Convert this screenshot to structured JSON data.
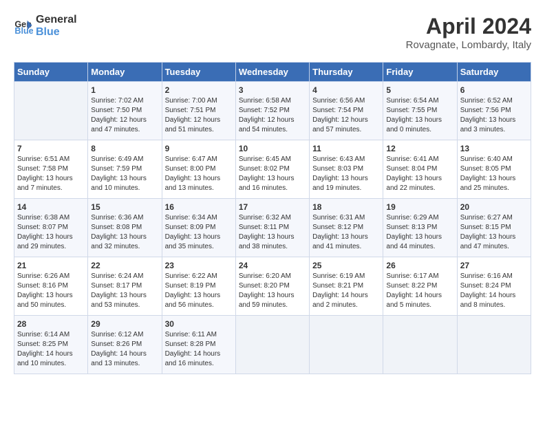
{
  "header": {
    "logo_line1": "General",
    "logo_line2": "Blue",
    "month_title": "April 2024",
    "location": "Rovagnate, Lombardy, Italy"
  },
  "weekdays": [
    "Sunday",
    "Monday",
    "Tuesday",
    "Wednesday",
    "Thursday",
    "Friday",
    "Saturday"
  ],
  "weeks": [
    [
      {
        "day": "",
        "sunrise": "",
        "sunset": "",
        "daylight": ""
      },
      {
        "day": "1",
        "sunrise": "Sunrise: 7:02 AM",
        "sunset": "Sunset: 7:50 PM",
        "daylight": "Daylight: 12 hours and 47 minutes."
      },
      {
        "day": "2",
        "sunrise": "Sunrise: 7:00 AM",
        "sunset": "Sunset: 7:51 PM",
        "daylight": "Daylight: 12 hours and 51 minutes."
      },
      {
        "day": "3",
        "sunrise": "Sunrise: 6:58 AM",
        "sunset": "Sunset: 7:52 PM",
        "daylight": "Daylight: 12 hours and 54 minutes."
      },
      {
        "day": "4",
        "sunrise": "Sunrise: 6:56 AM",
        "sunset": "Sunset: 7:54 PM",
        "daylight": "Daylight: 12 hours and 57 minutes."
      },
      {
        "day": "5",
        "sunrise": "Sunrise: 6:54 AM",
        "sunset": "Sunset: 7:55 PM",
        "daylight": "Daylight: 13 hours and 0 minutes."
      },
      {
        "day": "6",
        "sunrise": "Sunrise: 6:52 AM",
        "sunset": "Sunset: 7:56 PM",
        "daylight": "Daylight: 13 hours and 3 minutes."
      }
    ],
    [
      {
        "day": "7",
        "sunrise": "Sunrise: 6:51 AM",
        "sunset": "Sunset: 7:58 PM",
        "daylight": "Daylight: 13 hours and 7 minutes."
      },
      {
        "day": "8",
        "sunrise": "Sunrise: 6:49 AM",
        "sunset": "Sunset: 7:59 PM",
        "daylight": "Daylight: 13 hours and 10 minutes."
      },
      {
        "day": "9",
        "sunrise": "Sunrise: 6:47 AM",
        "sunset": "Sunset: 8:00 PM",
        "daylight": "Daylight: 13 hours and 13 minutes."
      },
      {
        "day": "10",
        "sunrise": "Sunrise: 6:45 AM",
        "sunset": "Sunset: 8:02 PM",
        "daylight": "Daylight: 13 hours and 16 minutes."
      },
      {
        "day": "11",
        "sunrise": "Sunrise: 6:43 AM",
        "sunset": "Sunset: 8:03 PM",
        "daylight": "Daylight: 13 hours and 19 minutes."
      },
      {
        "day": "12",
        "sunrise": "Sunrise: 6:41 AM",
        "sunset": "Sunset: 8:04 PM",
        "daylight": "Daylight: 13 hours and 22 minutes."
      },
      {
        "day": "13",
        "sunrise": "Sunrise: 6:40 AM",
        "sunset": "Sunset: 8:05 PM",
        "daylight": "Daylight: 13 hours and 25 minutes."
      }
    ],
    [
      {
        "day": "14",
        "sunrise": "Sunrise: 6:38 AM",
        "sunset": "Sunset: 8:07 PM",
        "daylight": "Daylight: 13 hours and 29 minutes."
      },
      {
        "day": "15",
        "sunrise": "Sunrise: 6:36 AM",
        "sunset": "Sunset: 8:08 PM",
        "daylight": "Daylight: 13 hours and 32 minutes."
      },
      {
        "day": "16",
        "sunrise": "Sunrise: 6:34 AM",
        "sunset": "Sunset: 8:09 PM",
        "daylight": "Daylight: 13 hours and 35 minutes."
      },
      {
        "day": "17",
        "sunrise": "Sunrise: 6:32 AM",
        "sunset": "Sunset: 8:11 PM",
        "daylight": "Daylight: 13 hours and 38 minutes."
      },
      {
        "day": "18",
        "sunrise": "Sunrise: 6:31 AM",
        "sunset": "Sunset: 8:12 PM",
        "daylight": "Daylight: 13 hours and 41 minutes."
      },
      {
        "day": "19",
        "sunrise": "Sunrise: 6:29 AM",
        "sunset": "Sunset: 8:13 PM",
        "daylight": "Daylight: 13 hours and 44 minutes."
      },
      {
        "day": "20",
        "sunrise": "Sunrise: 6:27 AM",
        "sunset": "Sunset: 8:15 PM",
        "daylight": "Daylight: 13 hours and 47 minutes."
      }
    ],
    [
      {
        "day": "21",
        "sunrise": "Sunrise: 6:26 AM",
        "sunset": "Sunset: 8:16 PM",
        "daylight": "Daylight: 13 hours and 50 minutes."
      },
      {
        "day": "22",
        "sunrise": "Sunrise: 6:24 AM",
        "sunset": "Sunset: 8:17 PM",
        "daylight": "Daylight: 13 hours and 53 minutes."
      },
      {
        "day": "23",
        "sunrise": "Sunrise: 6:22 AM",
        "sunset": "Sunset: 8:19 PM",
        "daylight": "Daylight: 13 hours and 56 minutes."
      },
      {
        "day": "24",
        "sunrise": "Sunrise: 6:20 AM",
        "sunset": "Sunset: 8:20 PM",
        "daylight": "Daylight: 13 hours and 59 minutes."
      },
      {
        "day": "25",
        "sunrise": "Sunrise: 6:19 AM",
        "sunset": "Sunset: 8:21 PM",
        "daylight": "Daylight: 14 hours and 2 minutes."
      },
      {
        "day": "26",
        "sunrise": "Sunrise: 6:17 AM",
        "sunset": "Sunset: 8:22 PM",
        "daylight": "Daylight: 14 hours and 5 minutes."
      },
      {
        "day": "27",
        "sunrise": "Sunrise: 6:16 AM",
        "sunset": "Sunset: 8:24 PM",
        "daylight": "Daylight: 14 hours and 8 minutes."
      }
    ],
    [
      {
        "day": "28",
        "sunrise": "Sunrise: 6:14 AM",
        "sunset": "Sunset: 8:25 PM",
        "daylight": "Daylight: 14 hours and 10 minutes."
      },
      {
        "day": "29",
        "sunrise": "Sunrise: 6:12 AM",
        "sunset": "Sunset: 8:26 PM",
        "daylight": "Daylight: 14 hours and 13 minutes."
      },
      {
        "day": "30",
        "sunrise": "Sunrise: 6:11 AM",
        "sunset": "Sunset: 8:28 PM",
        "daylight": "Daylight: 14 hours and 16 minutes."
      },
      {
        "day": "",
        "sunrise": "",
        "sunset": "",
        "daylight": ""
      },
      {
        "day": "",
        "sunrise": "",
        "sunset": "",
        "daylight": ""
      },
      {
        "day": "",
        "sunrise": "",
        "sunset": "",
        "daylight": ""
      },
      {
        "day": "",
        "sunrise": "",
        "sunset": "",
        "daylight": ""
      }
    ]
  ]
}
